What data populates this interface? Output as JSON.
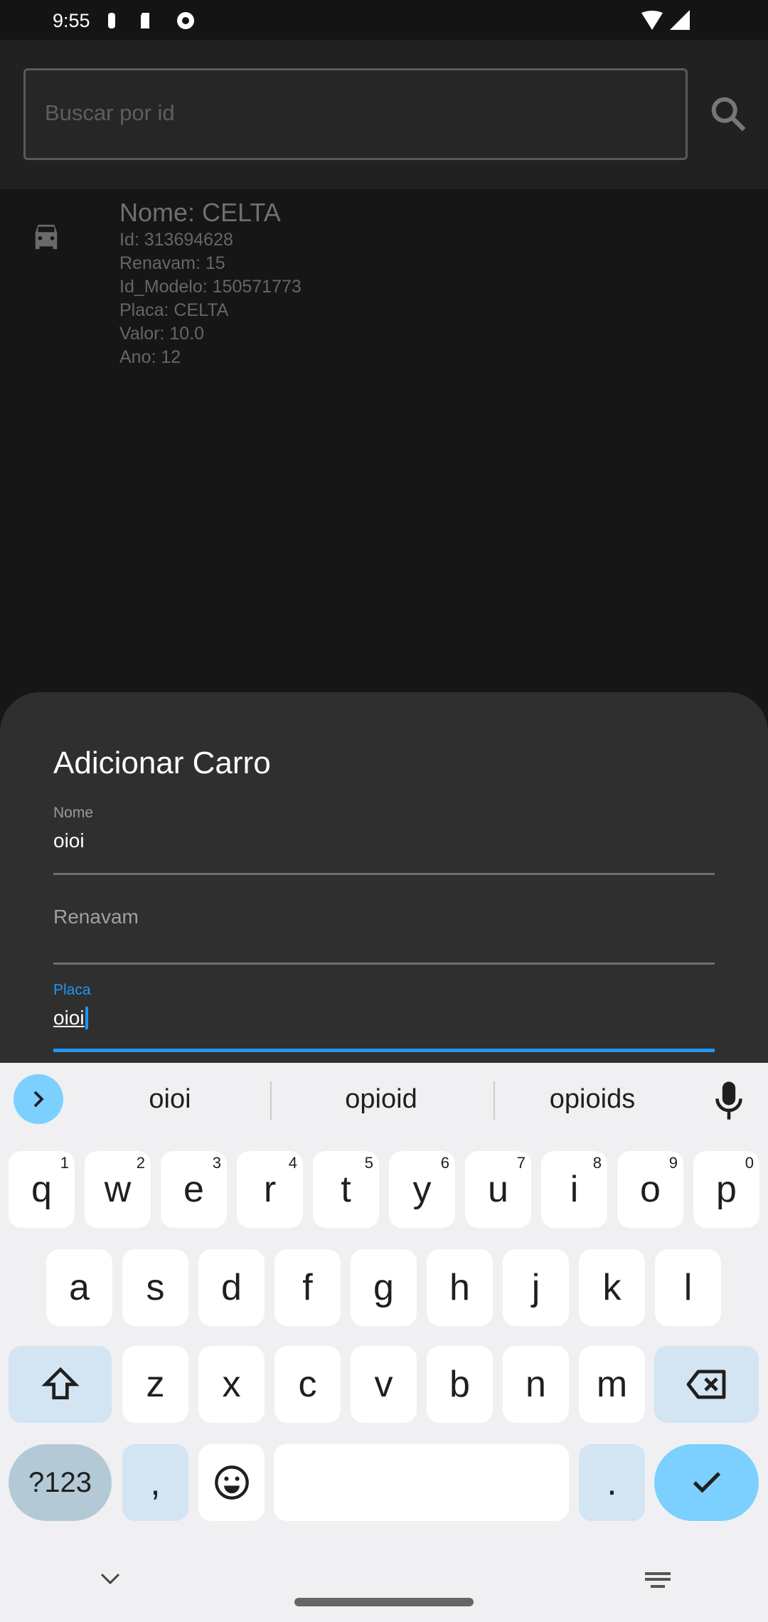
{
  "status": {
    "time": "9:55"
  },
  "search": {
    "placeholder": "Buscar por id"
  },
  "car": {
    "nome": "Nome: CELTA",
    "lines": [
      "Id: 313694628",
      "Renavam: 15",
      "Id_Modelo: 150571773",
      "Placa: CELTA",
      "Valor: 10.0",
      "Ano: 12"
    ]
  },
  "sheet": {
    "title": "Adicionar Carro",
    "fields": [
      {
        "label": "Nome",
        "value": "oioi"
      },
      {
        "label": "Renavam",
        "value": ""
      },
      {
        "label": "Placa",
        "value": "oioi"
      }
    ]
  },
  "keyboard": {
    "suggestions": [
      "oioi",
      "opioid",
      "opioids"
    ],
    "row1": [
      [
        "q",
        "1"
      ],
      [
        "w",
        "2"
      ],
      [
        "e",
        "3"
      ],
      [
        "r",
        "4"
      ],
      [
        "t",
        "5"
      ],
      [
        "y",
        "6"
      ],
      [
        "u",
        "7"
      ],
      [
        "i",
        "8"
      ],
      [
        "o",
        "9"
      ],
      [
        "p",
        "0"
      ]
    ],
    "row2": [
      "a",
      "s",
      "d",
      "f",
      "g",
      "h",
      "j",
      "k",
      "l"
    ],
    "row3": [
      "z",
      "x",
      "c",
      "v",
      "b",
      "n",
      "m"
    ],
    "symbols": "?123",
    "comma": ",",
    "period": "."
  },
  "colors": {
    "accent": "#2196f3",
    "keyboard_accent": "#7bd0ff"
  }
}
